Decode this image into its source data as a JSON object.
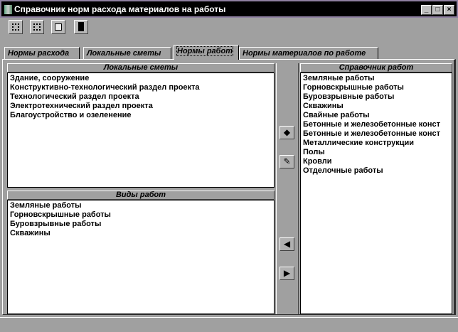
{
  "window": {
    "title": "Справочник норм расхода материалов на работы",
    "minimize": "_",
    "maximize": "□",
    "close": "×"
  },
  "toolbar": [
    {
      "icon": "move-left-icon"
    },
    {
      "icon": "move-right-icon"
    },
    {
      "icon": "report-icon"
    },
    {
      "icon": "exit-door-icon"
    }
  ],
  "tabs": [
    {
      "label": "Нормы расхода"
    },
    {
      "label": "Локальные сметы"
    },
    {
      "label": "Нормы работ",
      "selected": true
    },
    {
      "label": "Нормы материалов по работе"
    }
  ],
  "local_estimates": {
    "header": "Локальные сметы",
    "items": [
      "Здание, сооружение",
      "Конструктивно-технологический раздел проекта",
      "Технологический раздел проекта",
      "Электротехнический раздел проекта",
      "Благоустройство и озеленение"
    ]
  },
  "work_types": {
    "header": "Виды работ",
    "items": [
      "Земляные работы",
      "Горновскрышные работы",
      "Буровзрывные работы",
      "Скважины"
    ]
  },
  "work_catalog": {
    "header": "Справочник работ",
    "items": [
      "Земляные работы",
      "Горновскрышные работы",
      "Буровзрывные работы",
      "Скважины",
      "Свайные работы",
      "Бетонные и железобетонные конст",
      "Бетонные и железобетонные конст",
      "Металлические конструкции",
      "Полы",
      "Кровли",
      "Отделочные работы"
    ]
  },
  "middle_buttons": {
    "erase": "◆",
    "edit": "✎",
    "add_left": "◀",
    "add_right": "▶"
  }
}
